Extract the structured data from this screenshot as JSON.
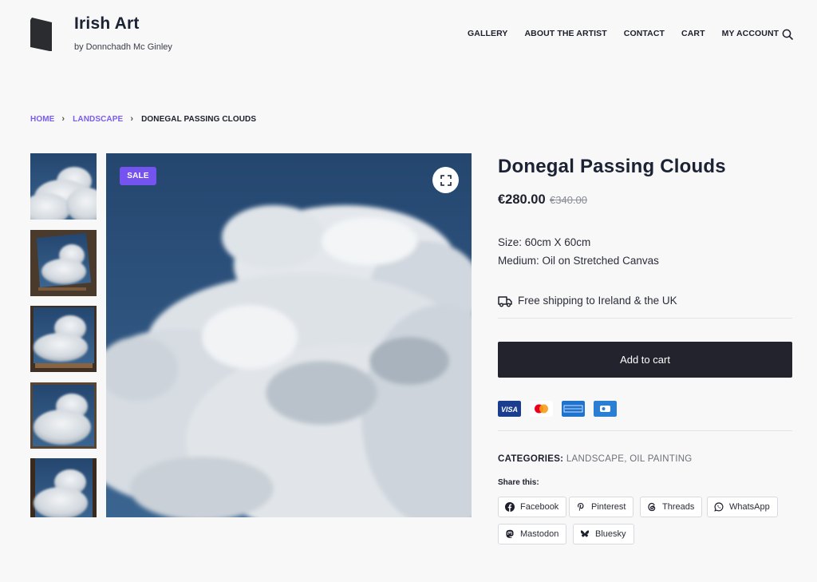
{
  "site": {
    "title": "Irish Art",
    "tagline": "by Donnchadh Mc Ginley"
  },
  "nav": {
    "items": [
      "GALLERY",
      "ABOUT THE ARTIST",
      "CONTACT",
      "CART",
      "MY ACCOUNT"
    ],
    "search_icon": "search-icon"
  },
  "breadcrumb": {
    "home": "HOME",
    "category": "LANDSCAPE",
    "current": "DONEGAL PASSING CLOUDS"
  },
  "gallery": {
    "sale_badge": "SALE",
    "zoom_icon": "fullscreen-icon",
    "thumbnail_count": 5
  },
  "product": {
    "title": "Donegal Passing Clouds",
    "price_current": "€280.00",
    "price_old": "€340.00",
    "size": "Size: 60cm X 60cm",
    "medium": "Medium: Oil on Stretched Canvas",
    "shipping": "Free shipping to Ireland & the UK",
    "add_to_cart": "Add to cart"
  },
  "payments": [
    "visa-icon",
    "mastercard-icon",
    "amex-icon",
    "card-icon"
  ],
  "meta": {
    "categories_label": "CATEGORIES:",
    "category_1": "LANDSCAPE",
    "separator": ", ",
    "category_2": "OIL PAINTING"
  },
  "share": {
    "label": "Share this:",
    "buttons": [
      "Facebook",
      "Pinterest",
      "Threads",
      "WhatsApp",
      "Mastodon",
      "Bluesky"
    ]
  },
  "colors": {
    "accent": "#7453ef",
    "button": "#22232d",
    "background": "#f8f8f9"
  }
}
